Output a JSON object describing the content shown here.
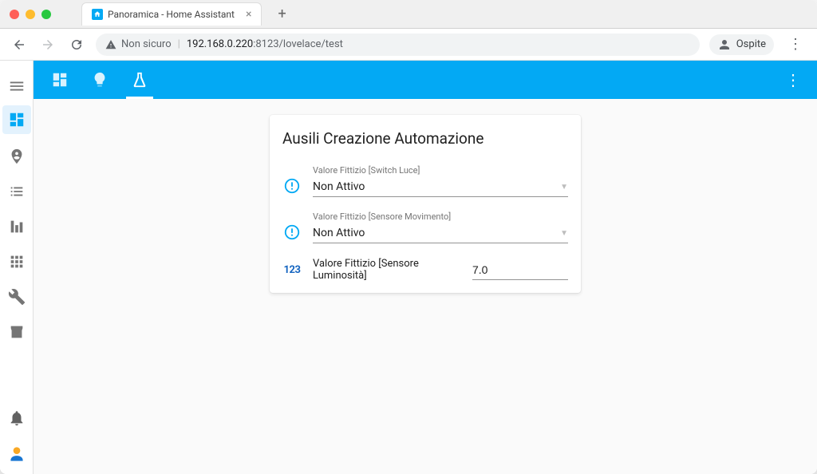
{
  "browser": {
    "tab_title": "Panoramica - Home Assistant",
    "security_label": "Non sicuro",
    "url_host": "192.168.0.220",
    "url_port_path": ":8123/lovelace/test",
    "profile_label": "Ospite"
  },
  "card": {
    "title": "Ausili Creazione Automazione",
    "rows": [
      {
        "label": "Valore Fittizio [Switch Luce]",
        "value": "Non Attivo"
      },
      {
        "label": "Valore Fittizio [Sensore Movimento]",
        "value": "Non Attivo"
      }
    ],
    "numeric": {
      "icon_text": "123",
      "label": "Valore Fittizio [Sensore Luminosità]",
      "value": "7.0"
    }
  }
}
